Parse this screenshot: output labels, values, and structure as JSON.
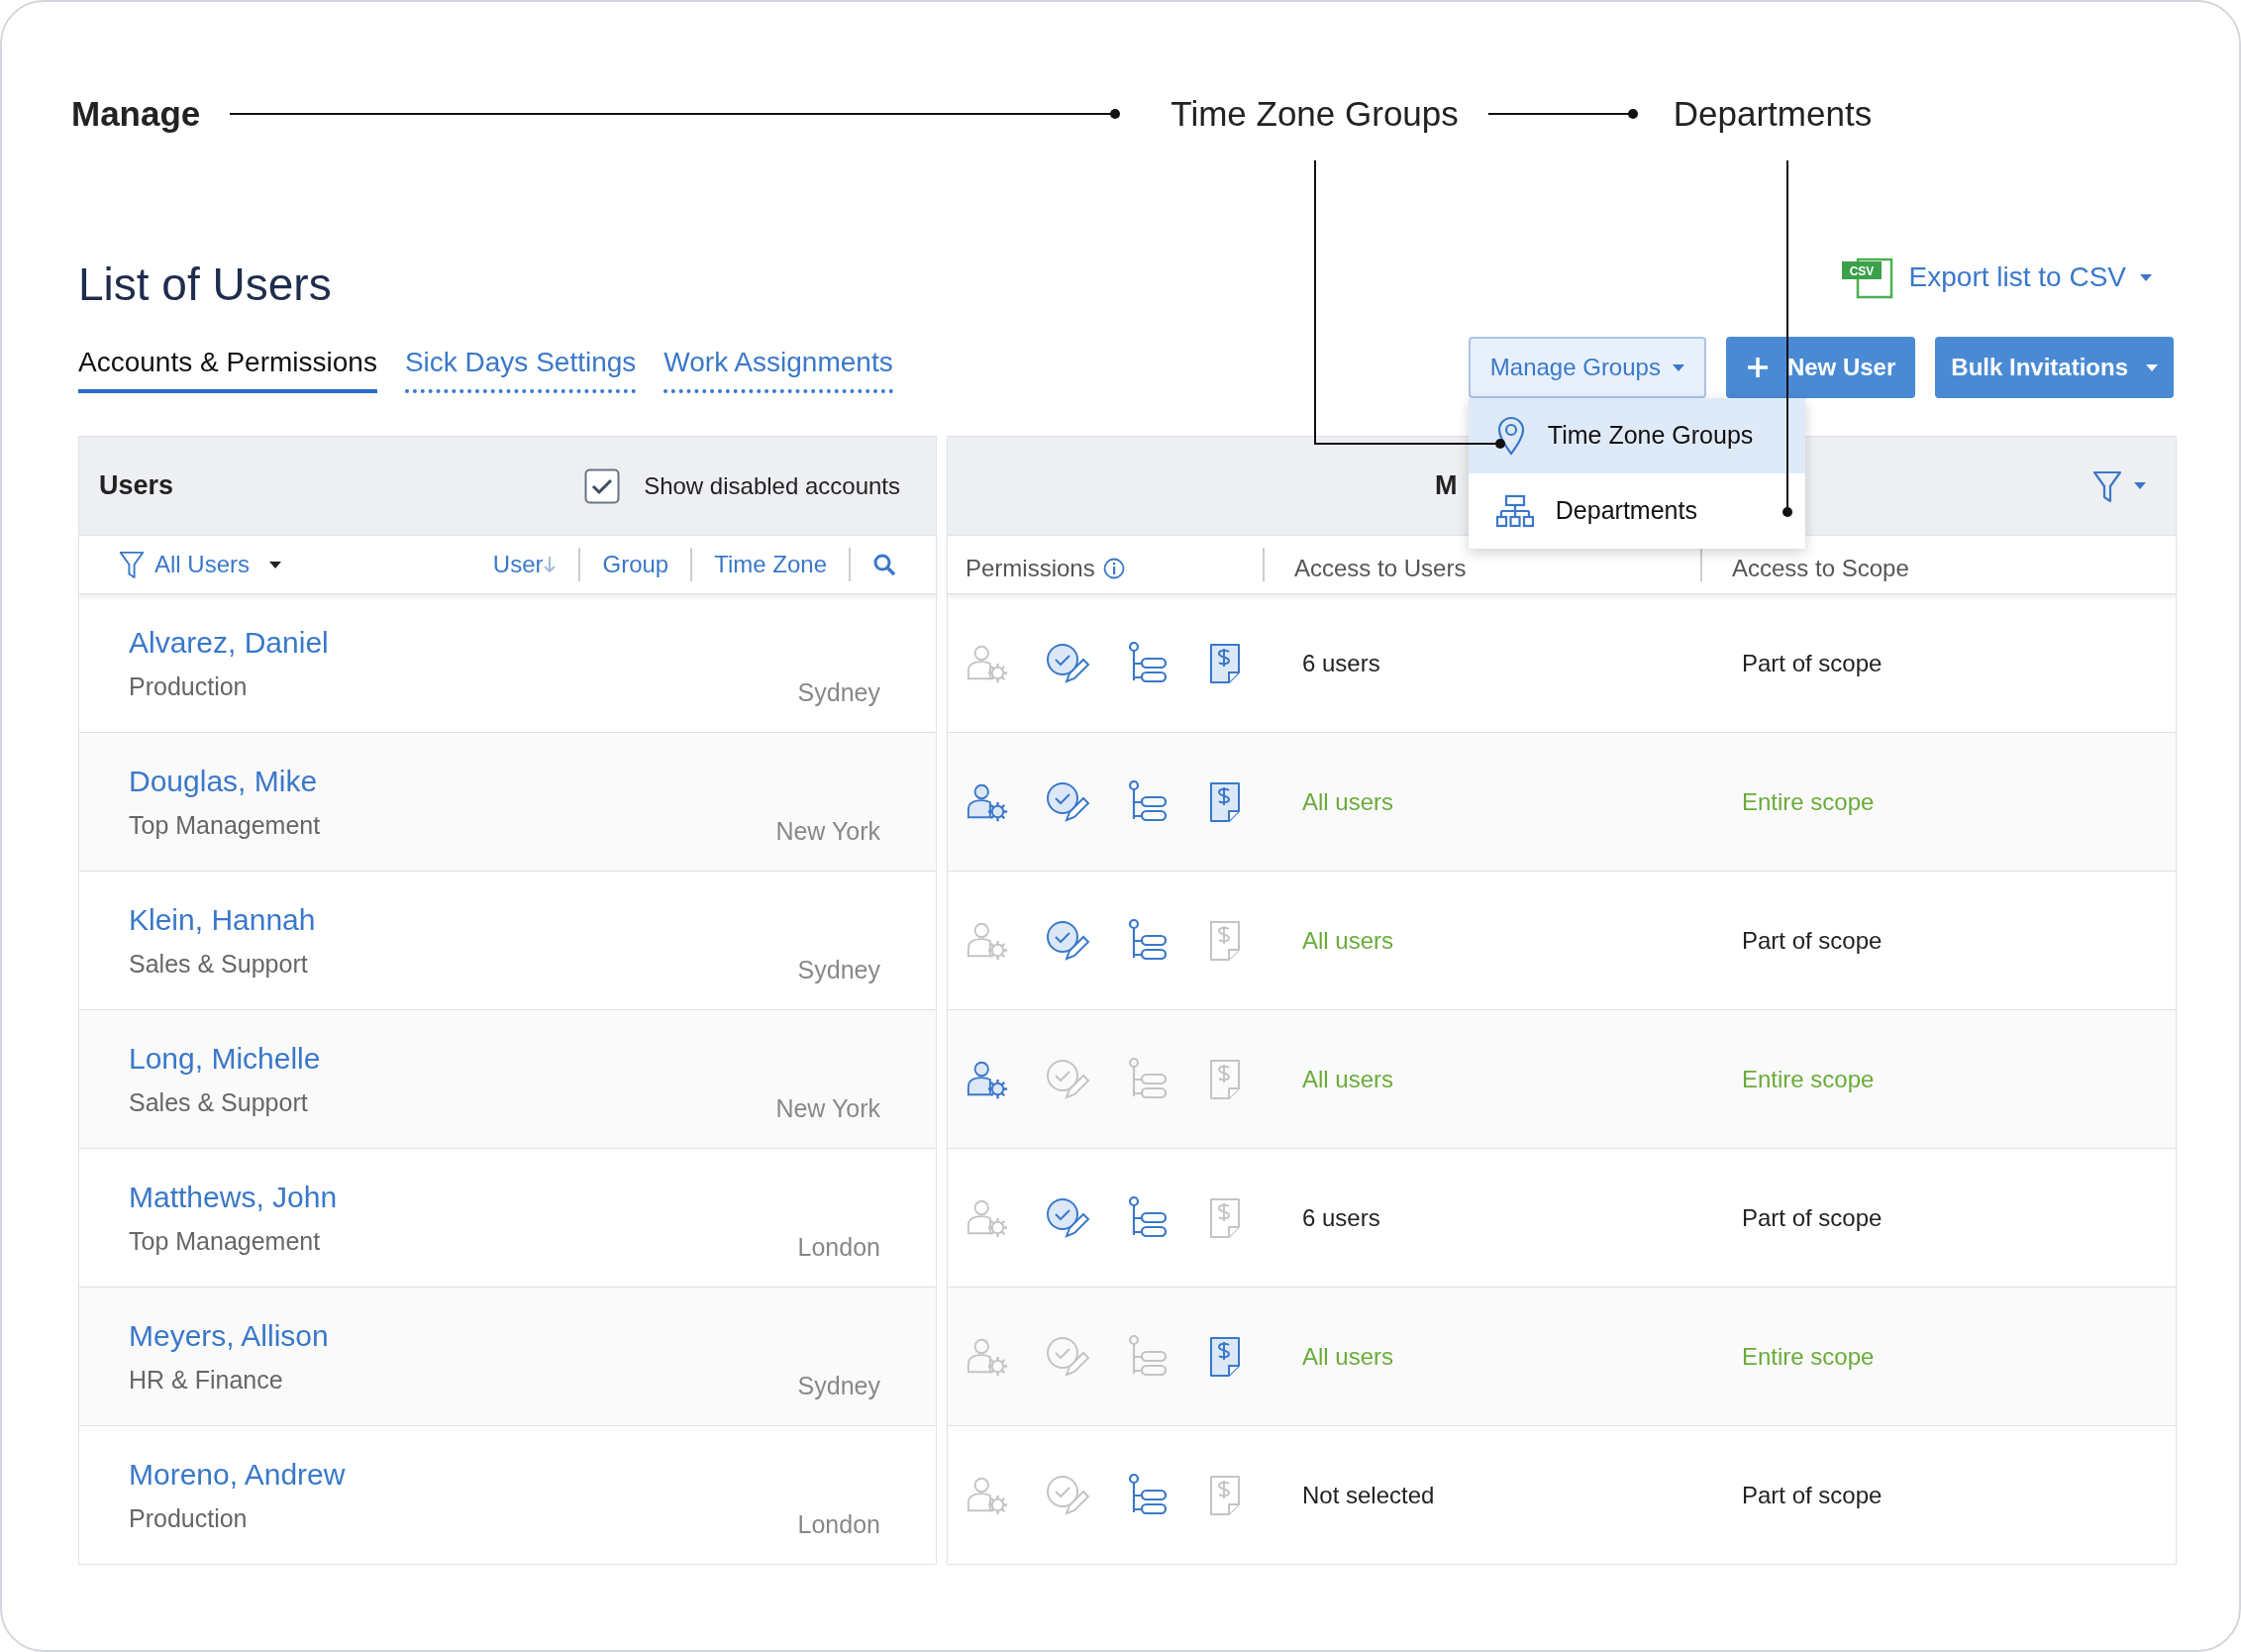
{
  "annotations": {
    "title": "Manage",
    "steps": [
      "Time Zone Groups",
      "Departments"
    ]
  },
  "page": {
    "title": "List of Users",
    "export": "Export list to CSV",
    "csv_badge": "CSV"
  },
  "tabs": [
    {
      "label": "Accounts & Permissions",
      "selected": true
    },
    {
      "label": "Sick Days Settings",
      "selected": false
    },
    {
      "label": "Work Assignments",
      "selected": false
    }
  ],
  "buttons": {
    "manage_groups": "Manage Groups",
    "new_user": "New User",
    "bulk_invitations": "Bulk Invitations"
  },
  "manage_groups_menu": {
    "open": true,
    "items": [
      {
        "label": "Time Zone Groups",
        "kind": "timezone",
        "selected": true
      },
      {
        "label": "Departments",
        "kind": "departments",
        "selected": false
      }
    ]
  },
  "users_panel": {
    "title": "Users",
    "show_disabled": {
      "label": "Show disabled accounts",
      "checked": true
    },
    "filter": "All Users",
    "columns": [
      {
        "label": "User",
        "sorted": true
      },
      {
        "label": "Group",
        "sorted": false
      },
      {
        "label": "Time Zone",
        "sorted": false
      }
    ]
  },
  "permissions_panel": {
    "title": "M",
    "columns": [
      "Permissions",
      "Access to Users",
      "Access to Scope"
    ]
  },
  "rows": [
    {
      "name": "Alvarez, Daniel",
      "group": "Production",
      "time_zone": "Sydney",
      "permissions": [
        false,
        true,
        true,
        true
      ],
      "access_users": {
        "text": "6 users",
        "full": false
      },
      "access_scope": {
        "text": "Part of scope",
        "full": false
      }
    },
    {
      "name": "Douglas, Mike",
      "group": "Top Management",
      "time_zone": "New York",
      "permissions": [
        true,
        true,
        true,
        true
      ],
      "access_users": {
        "text": "All users",
        "full": true
      },
      "access_scope": {
        "text": "Entire scope",
        "full": true
      }
    },
    {
      "name": "Klein, Hannah",
      "group": "Sales & Support",
      "time_zone": "Sydney",
      "permissions": [
        false,
        true,
        true,
        false
      ],
      "access_users": {
        "text": "All users",
        "full": true
      },
      "access_scope": {
        "text": "Part of scope",
        "full": false
      }
    },
    {
      "name": "Long, Michelle",
      "group": "Sales & Support",
      "time_zone": "New York",
      "permissions": [
        true,
        false,
        false,
        false
      ],
      "access_users": {
        "text": "All users",
        "full": true
      },
      "access_scope": {
        "text": "Entire scope",
        "full": true
      }
    },
    {
      "name": "Matthews, John",
      "group": "Top Management",
      "time_zone": "London",
      "permissions": [
        false,
        true,
        true,
        false
      ],
      "access_users": {
        "text": "6 users",
        "full": false
      },
      "access_scope": {
        "text": "Part of scope",
        "full": false
      }
    },
    {
      "name": "Meyers, Allison",
      "group": "HR & Finance",
      "time_zone": "Sydney",
      "permissions": [
        false,
        false,
        false,
        true
      ],
      "access_users": {
        "text": "All users",
        "full": true
      },
      "access_scope": {
        "text": "Entire scope",
        "full": true
      }
    },
    {
      "name": "Moreno, Andrew",
      "group": "Production",
      "time_zone": "London",
      "permissions": [
        false,
        false,
        true,
        false
      ],
      "access_users": {
        "text": "Not selected",
        "full": false
      },
      "access_scope": {
        "text": "Part of scope",
        "full": false
      }
    }
  ]
}
